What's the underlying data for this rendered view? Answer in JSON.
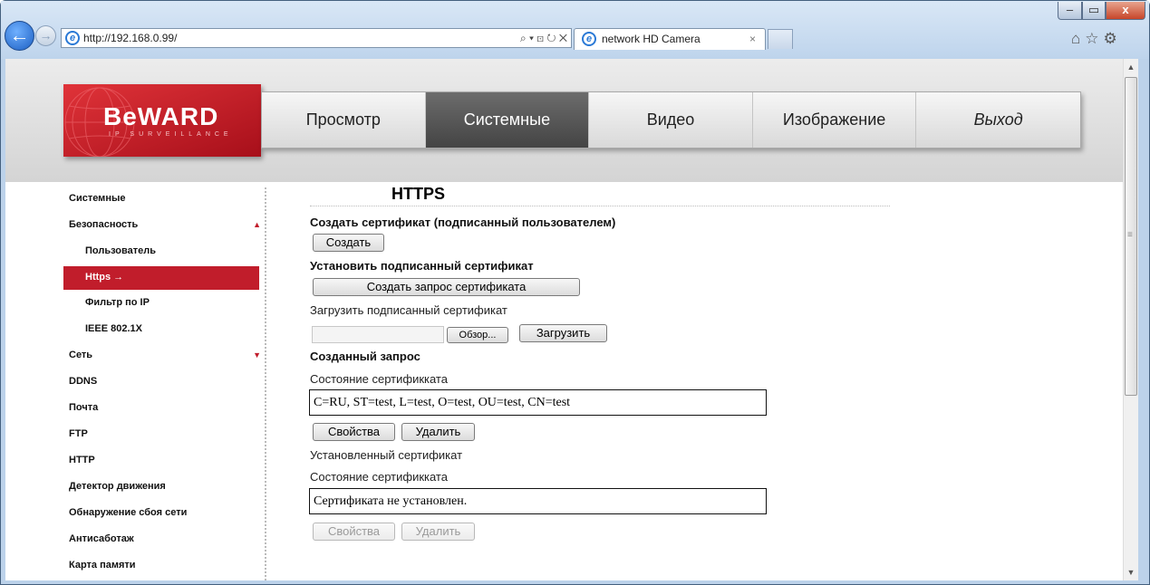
{
  "browser": {
    "url": "http://192.168.0.99/",
    "tab_title": "network HD Camera",
    "address_tools": "⌕ ▾ ⊡ ↻ ✕",
    "tab_close": "×",
    "window_controls": {
      "minimize": "–",
      "maximize": "▭",
      "close": "x"
    },
    "right_tools": "⌂☆⚙"
  },
  "logo": {
    "text": "BeWARD",
    "subtitle": "IP SURVEILLANCE"
  },
  "nav": [
    {
      "label": "Просмотр",
      "active": false
    },
    {
      "label": "Системные",
      "active": true
    },
    {
      "label": "Видео",
      "active": false
    },
    {
      "label": "Изображение",
      "active": false
    },
    {
      "label": "Выход",
      "active": false
    }
  ],
  "sidebar": [
    {
      "label": "Системные",
      "level": 0
    },
    {
      "label": "Безопасность",
      "level": 0,
      "caret": "▲"
    },
    {
      "label": "Пользователь",
      "level": 1
    },
    {
      "label": "Https →",
      "level": 1,
      "active": true
    },
    {
      "label": "Фильтр по IP",
      "level": 1
    },
    {
      "label": "IEEE 802.1X",
      "level": 1
    },
    {
      "label": "Сеть",
      "level": 0,
      "caret": "▼"
    },
    {
      "label": "DDNS",
      "level": 0
    },
    {
      "label": "Почта",
      "level": 0
    },
    {
      "label": "FTP",
      "level": 0
    },
    {
      "label": "HTTP",
      "level": 0
    },
    {
      "label": "Детектор движения",
      "level": 0
    },
    {
      "label": "Обнаружение сбоя сети",
      "level": 0
    },
    {
      "label": "Антисаботаж",
      "level": 0
    },
    {
      "label": "Карта памяти",
      "level": 0
    }
  ],
  "content": {
    "title": "HTTPS",
    "create_self_signed": {
      "heading": "Создать сертификат (подписанный пользователем)",
      "button": "Создать"
    },
    "install_signed": {
      "heading": "Установить подписанный сертификат",
      "request_button": "Создать запрос сертификата",
      "upload_label": "Загрузить подписанный сертификат",
      "browse_button": "Обзор...",
      "upload_button": "Загрузить"
    },
    "created_request": {
      "heading": "Созданный запрос",
      "status_label": "Состояние сертификката",
      "status_value": "C=RU, ST=test, L=test, O=test, OU=test, CN=test",
      "properties_button": "Свойства",
      "delete_button": "Удалить"
    },
    "installed_certificate": {
      "label": "Установленный сертификат",
      "status_label": "Состояние сертификката",
      "status_value": "Сертификата не установлен.",
      "properties_button": "Свойства",
      "delete_button": "Удалить"
    }
  },
  "colors": {
    "accent": "#c11d2b",
    "nav_active": "#555555",
    "logo_red": "#d22a32"
  }
}
